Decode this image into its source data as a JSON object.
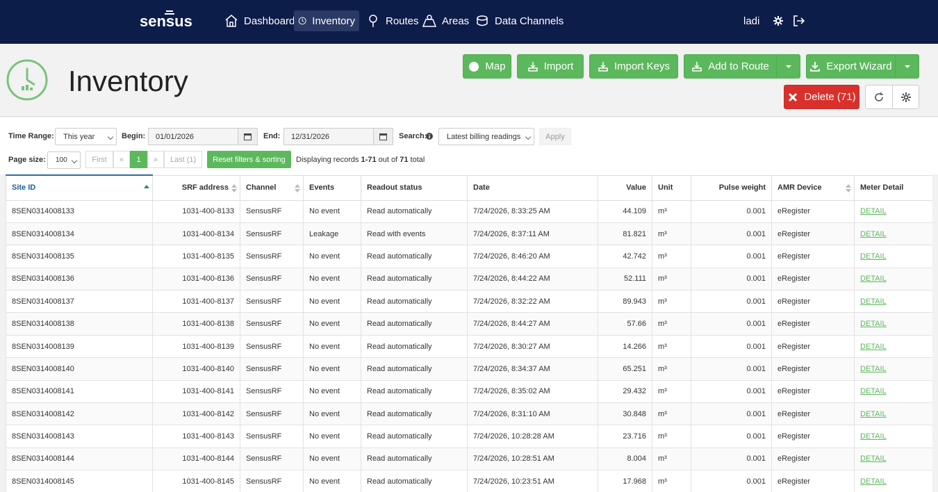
{
  "nav": {
    "logo_text": "sensus",
    "items": [
      {
        "label": "Dashboard",
        "icon": "home-icon"
      },
      {
        "label": "Inventory",
        "icon": "clock-icon"
      },
      {
        "label": "Routes",
        "icon": "map-pin-icon"
      },
      {
        "label": "Areas",
        "icon": "map-icon"
      },
      {
        "label": "Data Channels",
        "icon": "channels-icon"
      }
    ],
    "user": "ladi"
  },
  "header": {
    "title": "Inventory",
    "buttons": {
      "map": "Map",
      "import": "Import",
      "import_keys": "Import Keys",
      "add_to_route": "Add to Route",
      "export_wizard": "Export Wizard",
      "delete": "Delete (71)"
    }
  },
  "filters": {
    "time_range_label": "Time Range:",
    "time_range_value": "This year",
    "begin_label": "Begin:",
    "begin_value": "01/01/2026",
    "end_label": "End:",
    "end_value": "12/31/2026",
    "search_label": "Search:",
    "search_value": "Latest billing readings",
    "apply_label": "Apply",
    "page_size_label": "Page size:",
    "page_size_value": "100",
    "pager": {
      "first": "First",
      "prev": "«",
      "current": "1",
      "next": "»",
      "last": "Last (1)"
    },
    "reset_label": "Reset filters & sorting",
    "display_prefix": "Displaying records ",
    "display_range": "1-71",
    "display_mid": " out of ",
    "display_total": "71",
    "display_suffix": " total"
  },
  "table": {
    "columns": [
      "Site ID",
      "SRF address",
      "Channel",
      "Events",
      "Readout status",
      "Date",
      "Value",
      "Unit",
      "Pulse weight",
      "AMR Device",
      "Meter Detail"
    ],
    "rows": [
      [
        "8SEN0314008133",
        "1031-400-8133",
        "SensusRF",
        "No event",
        "Read automatically",
        "7/24/2026, 8:33:25 AM",
        "44.109",
        "m³",
        "0.001",
        "eRegister",
        "DETAIL"
      ],
      [
        "8SEN0314008134",
        "1031-400-8134",
        "SensusRF",
        "Leakage",
        "Read with events",
        "7/24/2026, 8:37:11 AM",
        "81.821",
        "m³",
        "0.001",
        "eRegister",
        "DETAIL"
      ],
      [
        "8SEN0314008135",
        "1031-400-8135",
        "SensusRF",
        "No event",
        "Read automatically",
        "7/24/2026, 8:46:20 AM",
        "42.742",
        "m³",
        "0.001",
        "eRegister",
        "DETAIL"
      ],
      [
        "8SEN0314008136",
        "1031-400-8136",
        "SensusRF",
        "No event",
        "Read automatically",
        "7/24/2026, 8:44:22 AM",
        "52.111",
        "m³",
        "0.001",
        "eRegister",
        "DETAIL"
      ],
      [
        "8SEN0314008137",
        "1031-400-8137",
        "SensusRF",
        "No event",
        "Read automatically",
        "7/24/2026, 8:32:22 AM",
        "89.943",
        "m³",
        "0.001",
        "eRegister",
        "DETAIL"
      ],
      [
        "8SEN0314008138",
        "1031-400-8138",
        "SensusRF",
        "No event",
        "Read automatically",
        "7/24/2026, 8:44:27 AM",
        "57.66",
        "m³",
        "0.001",
        "eRegister",
        "DETAIL"
      ],
      [
        "8SEN0314008139",
        "1031-400-8139",
        "SensusRF",
        "No event",
        "Read automatically",
        "7/24/2026, 8:30:27 AM",
        "14.266",
        "m³",
        "0.001",
        "eRegister",
        "DETAIL"
      ],
      [
        "8SEN0314008140",
        "1031-400-8140",
        "SensusRF",
        "No event",
        "Read automatically",
        "7/24/2026, 8:34:37 AM",
        "65.251",
        "m³",
        "0.001",
        "eRegister",
        "DETAIL"
      ],
      [
        "8SEN0314008141",
        "1031-400-8141",
        "SensusRF",
        "No event",
        "Read automatically",
        "7/24/2026, 8:35:02 AM",
        "29.432",
        "m³",
        "0.001",
        "eRegister",
        "DETAIL"
      ],
      [
        "8SEN0314008142",
        "1031-400-8142",
        "SensusRF",
        "No event",
        "Read automatically",
        "7/24/2026, 8:31:10 AM",
        "30.848",
        "m³",
        "0.001",
        "eRegister",
        "DETAIL"
      ],
      [
        "8SEN0314008143",
        "1031-400-8143",
        "SensusRF",
        "No event",
        "Read automatically",
        "7/24/2026, 10:28:28 AM",
        "23.716",
        "m³",
        "0.001",
        "eRegister",
        "DETAIL"
      ],
      [
        "8SEN0314008144",
        "1031-400-8144",
        "SensusRF",
        "No event",
        "Read automatically",
        "7/24/2026, 10:28:51 AM",
        "8.004",
        "m³",
        "0.001",
        "eRegister",
        "DETAIL"
      ],
      [
        "8SEN0314008145",
        "1031-400-8145",
        "SensusRF",
        "No event",
        "Read automatically",
        "7/24/2026, 10:23:51 AM",
        "17.968",
        "m³",
        "0.001",
        "eRegister",
        "DETAIL"
      ]
    ]
  },
  "colors": {
    "nav_bg": "#0d1d4a",
    "green": "#5cb85c",
    "red": "#d9302c"
  }
}
